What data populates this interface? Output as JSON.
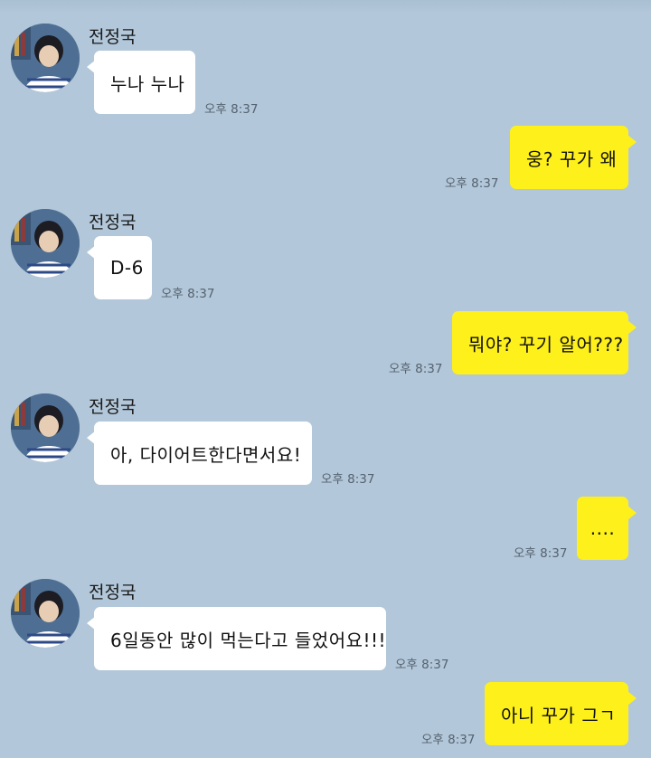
{
  "colors": {
    "background": "#b2c7d9",
    "bubble_other": "#ffffff",
    "bubble_me": "#fef01b",
    "time_text": "#556270"
  },
  "messages": [
    {
      "sender": "전정국",
      "text": "누나 누나",
      "time": "오후 8:37",
      "from": "other",
      "avatar_icon": "profile-photo-icon"
    },
    {
      "text": "웅? 꾸가 왜",
      "time": "오후 8:37",
      "from": "me"
    },
    {
      "sender": "전정국",
      "text": "D-6",
      "time": "오후 8:37",
      "from": "other",
      "avatar_icon": "profile-photo-icon"
    },
    {
      "text": "뭐야? 꾸기 알어???",
      "time": "오후 8:37",
      "from": "me"
    },
    {
      "sender": "전정국",
      "text": "아, 다이어트한다면서요!",
      "time": "오후 8:37",
      "from": "other",
      "avatar_icon": "profile-photo-icon"
    },
    {
      "text": "....",
      "time": "오후 8:37",
      "from": "me"
    },
    {
      "sender": "전정국",
      "text": "6일동안 많이 먹는다고 들었어요!!!",
      "time": "오후 8:37",
      "from": "other",
      "avatar_icon": "profile-photo-icon"
    },
    {
      "text": "아니 꾸가 그ㄱ",
      "time": "오후 8:37",
      "from": "me"
    }
  ]
}
